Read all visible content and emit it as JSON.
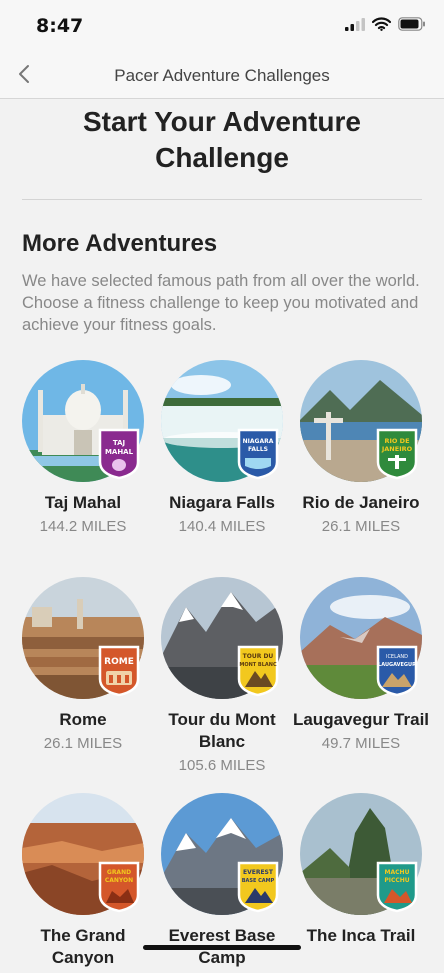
{
  "status_bar": {
    "time": "8:47"
  },
  "nav": {
    "title": "Pacer Adventure Challenges"
  },
  "page": {
    "title": "Start Your Adventure Challenge"
  },
  "section": {
    "heading": "More Adventures",
    "description": "We have selected famous path from all over the world. Choose a fitness challenge to keep you motivated and achieve your fitness goals."
  },
  "adventures": [
    {
      "name": "Taj Mahal",
      "miles": "144.2 MILES",
      "badge_line1": "TAJ",
      "badge_line2": "MAHAL"
    },
    {
      "name": "Niagara Falls",
      "miles": "140.4 MILES",
      "badge_line1": "NIAGARA",
      "badge_line2": "FALLS"
    },
    {
      "name": "Rio de Janeiro",
      "miles": "26.1 MILES",
      "badge_line1": "RIO DE",
      "badge_line2": "JANEIRO"
    },
    {
      "name": "Rome",
      "miles": "26.1 MILES",
      "badge_line1": "ROME",
      "badge_line2": ""
    },
    {
      "name": "Tour du Mont Blanc",
      "miles": "105.6 MILES",
      "badge_line1": "TOUR DU",
      "badge_line2": "MONT BLANC"
    },
    {
      "name": "Laugavegur Trail",
      "miles": "49.7 MILES",
      "badge_line1": "ICELAND",
      "badge_line2": "LAUGAVEGUR"
    },
    {
      "name": "The Grand Canyon",
      "miles": "",
      "badge_line1": "GRAND",
      "badge_line2": "CANYON"
    },
    {
      "name": "Everest Base Camp",
      "miles": "",
      "badge_line1": "EVEREST",
      "badge_line2": "BASE CAMP"
    },
    {
      "name": "The Inca Trail",
      "miles": "",
      "badge_line1": "MACHU",
      "badge_line2": "PICCHU"
    }
  ],
  "colors": {
    "background": "#f2f2f2",
    "header": "#f7f7f7",
    "text_primary": "#222222",
    "text_secondary": "#888888",
    "badge_purple": "#8a2a8f",
    "badge_blue": "#2a5aa8",
    "badge_green": "#2f8a3c",
    "badge_orange": "#d4572a",
    "badge_yellow": "#f2c81e",
    "badge_teal": "#1f9a8a"
  },
  "icons": {
    "back": "chevron-left-icon",
    "signal": "signal-bars-icon",
    "wifi": "wifi-icon",
    "battery": "battery-icon"
  }
}
